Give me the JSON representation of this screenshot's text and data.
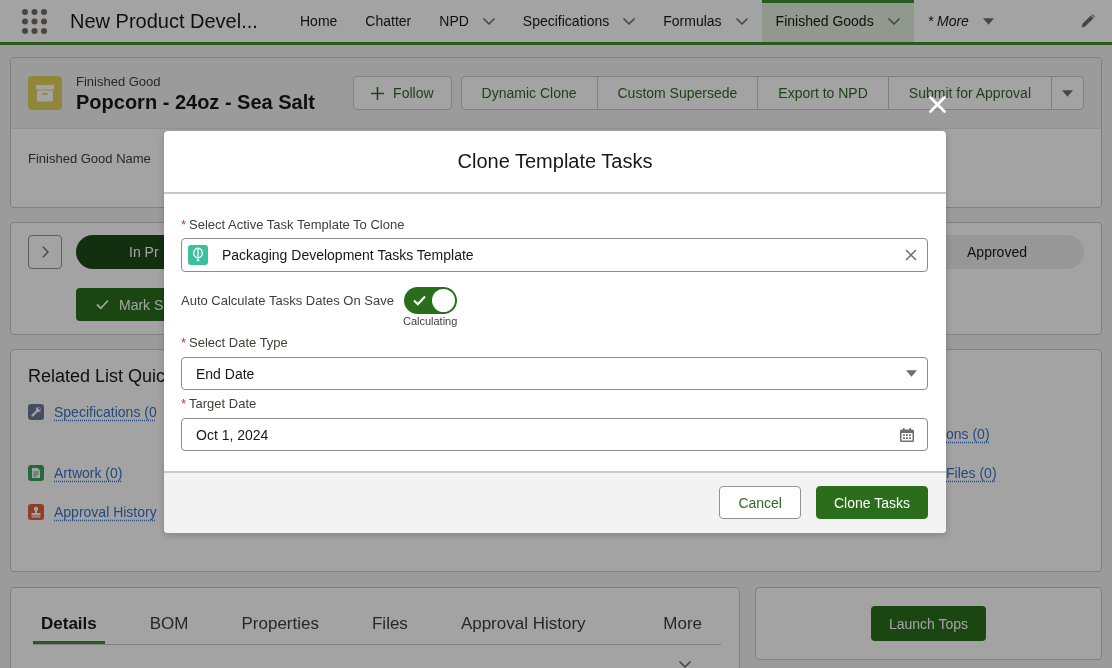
{
  "nav": {
    "app_name": "New Product Devel...",
    "items": [
      {
        "label": "Home",
        "kind": "link",
        "selected": false
      },
      {
        "label": "Chatter",
        "kind": "link",
        "selected": false
      },
      {
        "label": "NPD",
        "kind": "menu",
        "selected": false
      },
      {
        "label": "Specifications",
        "kind": "menu",
        "selected": false
      },
      {
        "label": "Formulas",
        "kind": "menu",
        "selected": false
      },
      {
        "label": "Finished Goods",
        "kind": "menu",
        "selected": true
      },
      {
        "label": "* More",
        "kind": "more",
        "selected": false
      }
    ]
  },
  "record_header": {
    "object_type": "Finished Good",
    "title": "Popcorn - 24oz - Sea Salt",
    "follow_button": "Follow",
    "actions": [
      "Dynamic Clone",
      "Custom Supersede",
      "Export to NPD",
      "Submit for Approval"
    ],
    "field_label": "Finished Good Name"
  },
  "path": {
    "stages": [
      {
        "label": "In Pr",
        "selected": true
      },
      {
        "label": "Approved",
        "selected": false
      }
    ],
    "mark_button": "Mark S"
  },
  "related_list": {
    "title": "Related List Quic",
    "rows": [
      {
        "left": {
          "label": "Specifications (0",
          "kind": "specifications"
        },
        "right": {
          "label": "ons (0)"
        }
      },
      {
        "left": {
          "label": "Artwork (0)",
          "kind": "artwork"
        },
        "right": {
          "label": "Files (0)"
        }
      },
      {
        "left": {
          "label": "Approval History",
          "kind": "approval"
        }
      }
    ]
  },
  "tabs": [
    {
      "label": "Details",
      "selected": true
    },
    {
      "label": "BOM",
      "selected": false
    },
    {
      "label": "Properties",
      "selected": false
    },
    {
      "label": "Files",
      "selected": false
    },
    {
      "label": "Approval History",
      "selected": false
    },
    {
      "label": "More",
      "selected": false
    }
  ],
  "launch_button": "Launch Tops",
  "modal": {
    "title": "Clone Template Tasks",
    "template_field": {
      "required_mark": "*",
      "label": "Select Active Task Template To Clone",
      "value": "Packaging Development Tasks Template"
    },
    "auto_calculate": {
      "label": "Auto Calculate Tasks Dates On Save",
      "on": true,
      "status": "Calculating"
    },
    "date_type": {
      "required_mark": "*",
      "label": "Select Date Type",
      "value": "End Date"
    },
    "target_date": {
      "required_mark": "*",
      "label": "Target Date",
      "value": "Oct 1, 2024"
    },
    "buttons": [
      {
        "label": "Cancel",
        "kind": "neutral"
      },
      {
        "label": "Clone Tasks",
        "kind": "brand"
      }
    ]
  }
}
